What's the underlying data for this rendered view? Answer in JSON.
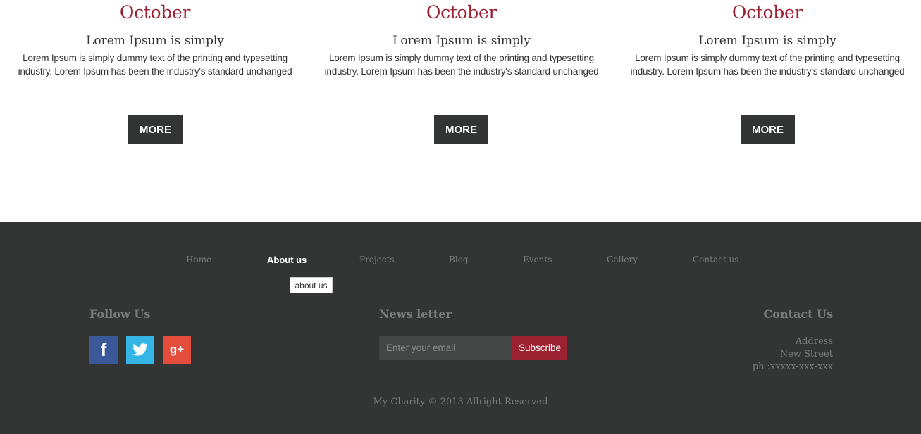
{
  "events": [
    {
      "month": "October",
      "title": "Lorem Ipsum is simply",
      "desc_line1": "Lorem Ipsum is simply dummy text of the printing and typesetting",
      "desc_line2": "industry. Lorem Ipsum has been the industry's standard unchanged",
      "more_label": "MORE"
    },
    {
      "month": "October",
      "title": "Lorem Ipsum is simply",
      "desc_line1": "Lorem Ipsum is simply dummy text of the printing and typesetting",
      "desc_line2": "industry. Lorem Ipsum has been the industry's standard unchanged",
      "more_label": "MORE"
    },
    {
      "month": "October",
      "title": "Lorem Ipsum is simply",
      "desc_line1": "Lorem Ipsum is simply dummy text of the printing and typesetting",
      "desc_line2": "industry. Lorem Ipsum has been the industry's standard unchanged",
      "more_label": "MORE"
    }
  ],
  "footer": {
    "nav": {
      "items": [
        "Home",
        "About us",
        "Projects",
        "Blog",
        "Events",
        "Gallery",
        "Contact us"
      ],
      "active": "About us",
      "tooltip": "about us"
    },
    "follow": {
      "title": "Follow Us",
      "icons": [
        "facebook-icon",
        "twitter-icon",
        "google-plus-icon"
      ],
      "facebook_glyph": "f",
      "google_glyph": "g+"
    },
    "newsletter": {
      "title": "News letter",
      "placeholder": "Enter your email",
      "button": "Subscribe"
    },
    "contact": {
      "title": "Contact Us",
      "address": "Address",
      "street": "New Street",
      "phone": "ph :xxxxx-xxx-xxx"
    },
    "copyright": "My Charity © 2013 Allright Reserved"
  },
  "colors": {
    "accent": "#9b2030",
    "dark": "#333535",
    "facebook": "#3b5998",
    "twitter": "#33b5e5",
    "google": "#e44c3c"
  }
}
